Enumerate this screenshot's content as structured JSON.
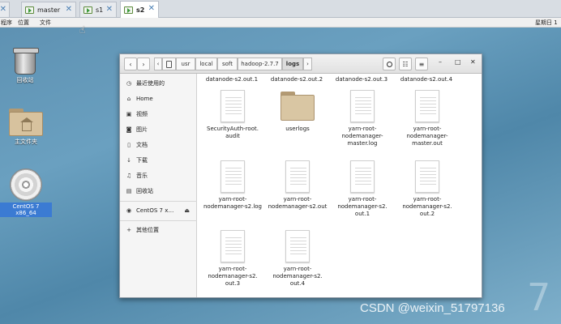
{
  "vm_tabs": [
    {
      "label": "",
      "close": "✕"
    },
    {
      "label": "master",
      "close": "✕"
    },
    {
      "label": "s1",
      "close": "✕"
    },
    {
      "label": "s2",
      "close": "✕"
    }
  ],
  "topbar": {
    "applications": "程序",
    "places": "位置",
    "file": "文件",
    "clock": "星期日 1"
  },
  "desktop": {
    "trash": "回收站",
    "home": "主文件夹",
    "disc": "CentOS 7 x86_64"
  },
  "window": {
    "nav": {
      "back": "‹",
      "forward": "›",
      "left_arrow": "‹",
      "right_arrow": "›"
    },
    "breadcrumbs": [
      "usr",
      "local",
      "soft",
      "hadoop-2.7.7",
      "logs"
    ],
    "controls": {
      "minimize": "–",
      "maximize": "□",
      "close": "✕"
    },
    "sidebar": [
      {
        "icon": "clock-icon",
        "glyph": "◷",
        "label": "最近使用的"
      },
      {
        "icon": "home-icon",
        "glyph": "⌂",
        "label": "Home"
      },
      {
        "icon": "video-icon",
        "glyph": "▣",
        "label": "视频"
      },
      {
        "icon": "picture-icon",
        "glyph": "◙",
        "label": "图片"
      },
      {
        "icon": "document-icon",
        "glyph": "▯",
        "label": "文档"
      },
      {
        "icon": "download-icon",
        "glyph": "↓",
        "label": "下载"
      },
      {
        "icon": "music-icon",
        "glyph": "♫",
        "label": "音乐"
      },
      {
        "icon": "trash-icon",
        "glyph": "▤",
        "label": "回收站"
      },
      {
        "icon": "disc-icon",
        "glyph": "◉",
        "label": "CentOS 7 x…"
      },
      {
        "icon": "plus-icon",
        "glyph": "+",
        "label": "其他位置"
      }
    ],
    "eject": "⏏",
    "partial_row": [
      "datanode-s2.out.1",
      "datanode-s2.out.2",
      "datanode-s2.out.3",
      "datanode-s2.out.4"
    ],
    "files": [
      {
        "type": "doc",
        "lines": [
          "SecurityAuth-root.",
          "audit"
        ]
      },
      {
        "type": "folder",
        "lines": [
          "userlogs"
        ]
      },
      {
        "type": "doc",
        "lines": [
          "yarn-root-",
          "nodemanager-",
          "master.log"
        ]
      },
      {
        "type": "doc",
        "lines": [
          "yarn-root-",
          "nodemanager-",
          "master.out"
        ]
      },
      {
        "type": "doc",
        "lines": [
          "yarn-root-",
          "nodemanager-s2.log"
        ]
      },
      {
        "type": "doc",
        "lines": [
          "yarn-root-",
          "nodemanager-s2.out"
        ]
      },
      {
        "type": "doc",
        "lines": [
          "yarn-root-",
          "nodemanager-s2.",
          "out.1"
        ]
      },
      {
        "type": "doc",
        "lines": [
          "yarn-root-",
          "nodemanager-s2.",
          "out.2"
        ]
      },
      {
        "type": "doc",
        "lines": [
          "yarn-root-",
          "nodemanager-s2.",
          "out.3"
        ]
      },
      {
        "type": "doc",
        "lines": [
          "yarn-root-",
          "nodemanager-s2.",
          "out.4"
        ]
      }
    ]
  },
  "watermark": "CSDN @weixin_51797136",
  "overlay_digit": "7"
}
